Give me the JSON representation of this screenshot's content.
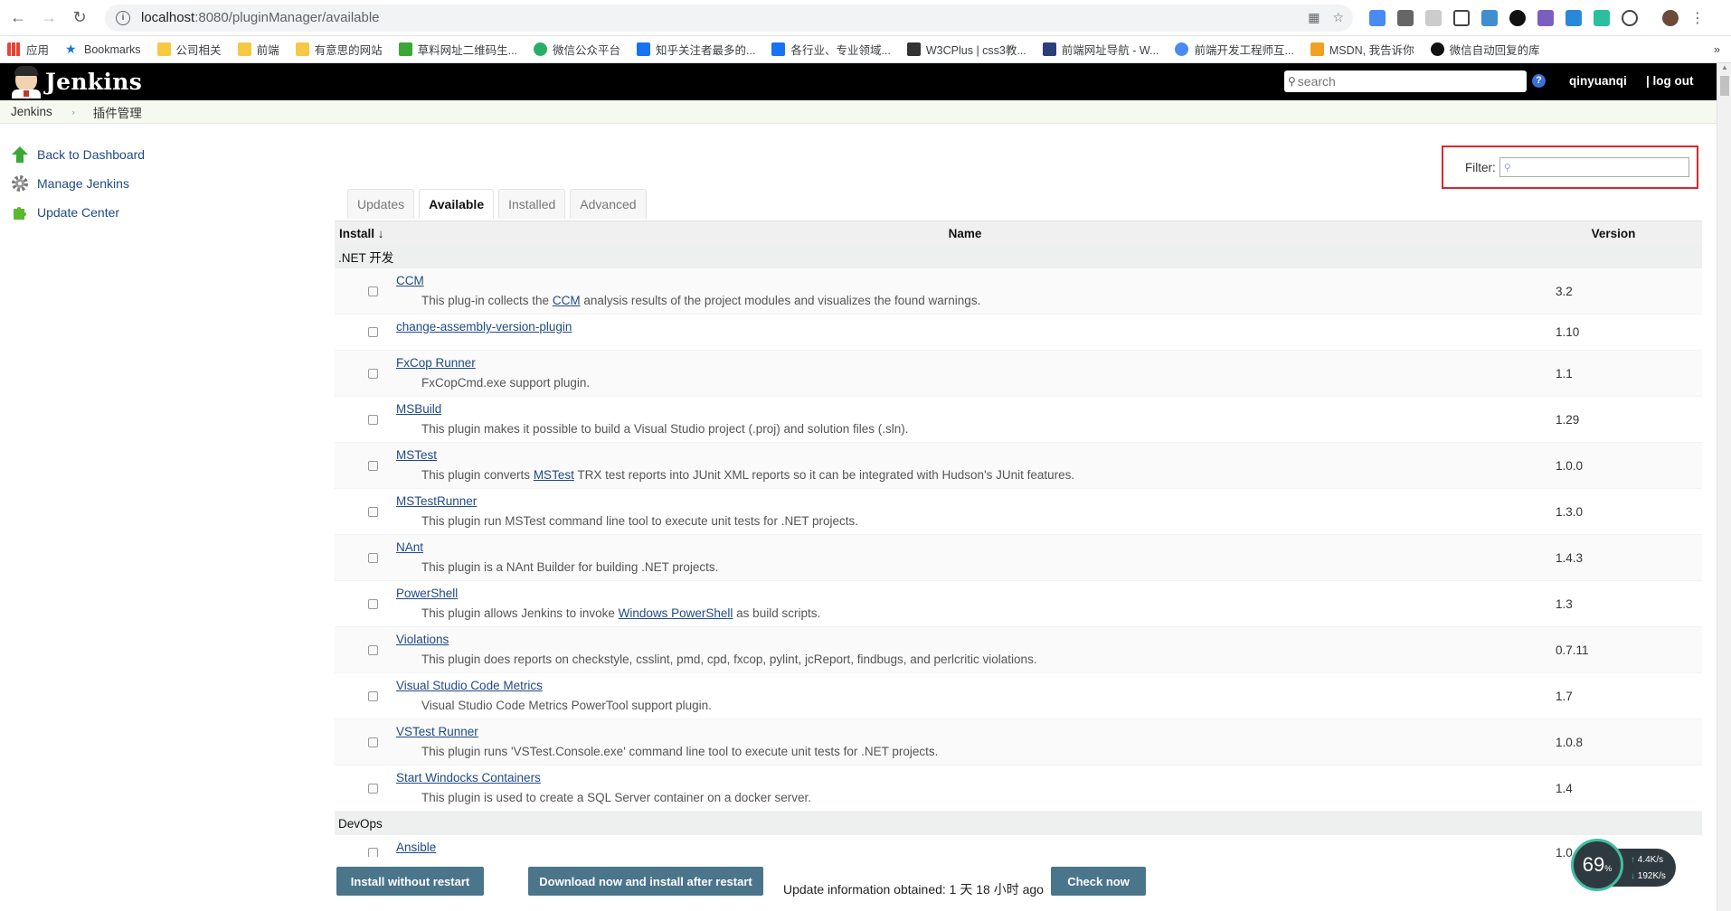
{
  "browser": {
    "url_host": "localhost",
    "url_path": ":8080/pluginManager/available",
    "bookmarks": [
      {
        "label": "应用"
      },
      {
        "label": "Bookmarks"
      },
      {
        "label": "公司相关"
      },
      {
        "label": "前端"
      },
      {
        "label": "有意思的网站"
      },
      {
        "label": "草料网址二维码生..."
      },
      {
        "label": "微信公众平台"
      },
      {
        "label": "知乎关注者最多的..."
      },
      {
        "label": "各行业、专业领域..."
      },
      {
        "label": "W3CPlus | css3教..."
      },
      {
        "label": "前端网址导航 - W..."
      },
      {
        "label": "前端开发工程师互..."
      },
      {
        "label": "MSDN, 我告诉你"
      },
      {
        "label": "微信自动回复的库"
      }
    ],
    "more_bookmarks": "»"
  },
  "header": {
    "logo_text": "Jenkins",
    "search_placeholder": "search",
    "help": "?",
    "user": "qinyuanqi",
    "logout": "| log out"
  },
  "breadcrumb": {
    "root": "Jenkins",
    "separator": "›",
    "current": "插件管理"
  },
  "side_panel": [
    {
      "label": "Back to Dashboard",
      "icon": "up-arrow-icon"
    },
    {
      "label": "Manage Jenkins",
      "icon": "gear-icon"
    },
    {
      "label": "Update Center",
      "icon": "puzzle-icon"
    }
  ],
  "filter": {
    "label": "Filter:",
    "value": ""
  },
  "tabs": [
    {
      "label": "Updates",
      "active": false
    },
    {
      "label": "Available",
      "active": true
    },
    {
      "label": "Installed",
      "active": false
    },
    {
      "label": "Advanced",
      "active": false
    }
  ],
  "table": {
    "col_install": "Install ↓",
    "col_name": "Name",
    "col_version": "Version",
    "categories": [
      {
        "name": ".NET 开发",
        "plugins": [
          {
            "name": "CCM",
            "desc_pre": "This plug-in collects the ",
            "desc_link": "CCM",
            "desc_post": " analysis results of the project modules and visualizes the found warnings.",
            "version": "3.2"
          },
          {
            "name": "change-assembly-version-plugin",
            "desc_pre": "",
            "desc_link": "",
            "desc_post": "",
            "version": "1.10"
          },
          {
            "name": "FxCop Runner",
            "desc_pre": "FxCopCmd.exe support plugin.",
            "desc_link": "",
            "desc_post": "",
            "version": "1.1"
          },
          {
            "name": "MSBuild",
            "desc_pre": "This plugin makes it possible to build a Visual Studio project (.proj) and solution files (.sln).",
            "desc_link": "",
            "desc_post": "",
            "version": "1.29"
          },
          {
            "name": "MSTest",
            "desc_pre": "This plugin converts ",
            "desc_link": "MSTest",
            "desc_post": " TRX test reports into JUnit XML reports so it can be integrated with Hudson's JUnit features.",
            "version": "1.0.0"
          },
          {
            "name": "MSTestRunner",
            "desc_pre": "This plugin run MSTest command line tool to execute unit tests for .NET projects.",
            "desc_link": "",
            "desc_post": "",
            "version": "1.3.0"
          },
          {
            "name": "NAnt",
            "desc_pre": "This plugin is a NAnt Builder for building .NET projects.",
            "desc_link": "",
            "desc_post": "",
            "version": "1.4.3"
          },
          {
            "name": "PowerShell",
            "desc_pre": "This plugin allows Jenkins to invoke ",
            "desc_link": "Windows PowerShell",
            "desc_post": " as build scripts.",
            "version": "1.3"
          },
          {
            "name": "Violations",
            "desc_pre": "This plugin does reports on checkstyle, csslint, pmd, cpd, fxcop, pylint, jcReport, findbugs, and perlcritic violations.",
            "desc_link": "",
            "desc_post": "",
            "version": "0.7.11"
          },
          {
            "name": "Visual Studio Code Metrics",
            "desc_pre": "Visual Studio Code Metrics PowerTool support plugin.",
            "desc_link": "",
            "desc_post": "",
            "version": "1.7"
          },
          {
            "name": "VSTest Runner",
            "desc_pre": "This plugin runs 'VSTest.Console.exe' command line tool to execute unit tests for .NET projects.",
            "desc_link": "",
            "desc_post": "",
            "version": "1.0.8"
          },
          {
            "name": "Start Windocks Containers",
            "desc_pre": "This plugin is used to create a SQL Server container on a docker server.",
            "desc_link": "",
            "desc_post": "",
            "version": "1.4"
          }
        ]
      },
      {
        "name": "DevOps",
        "plugins": [
          {
            "name": "Ansible",
            "desc_pre": "",
            "desc_link": "",
            "desc_post": "",
            "version": "1.0"
          }
        ]
      }
    ]
  },
  "bottom": {
    "install_without_restart": "Install without restart",
    "download_install_after_restart": "Download now and install after restart",
    "update_info": "Update information obtained: 1 天 18 小时 ago",
    "check_now": "Check now"
  },
  "net_monitor": {
    "percent": "69",
    "percent_unit": "%",
    "up": "4.4K/s",
    "down": "192K/s"
  }
}
